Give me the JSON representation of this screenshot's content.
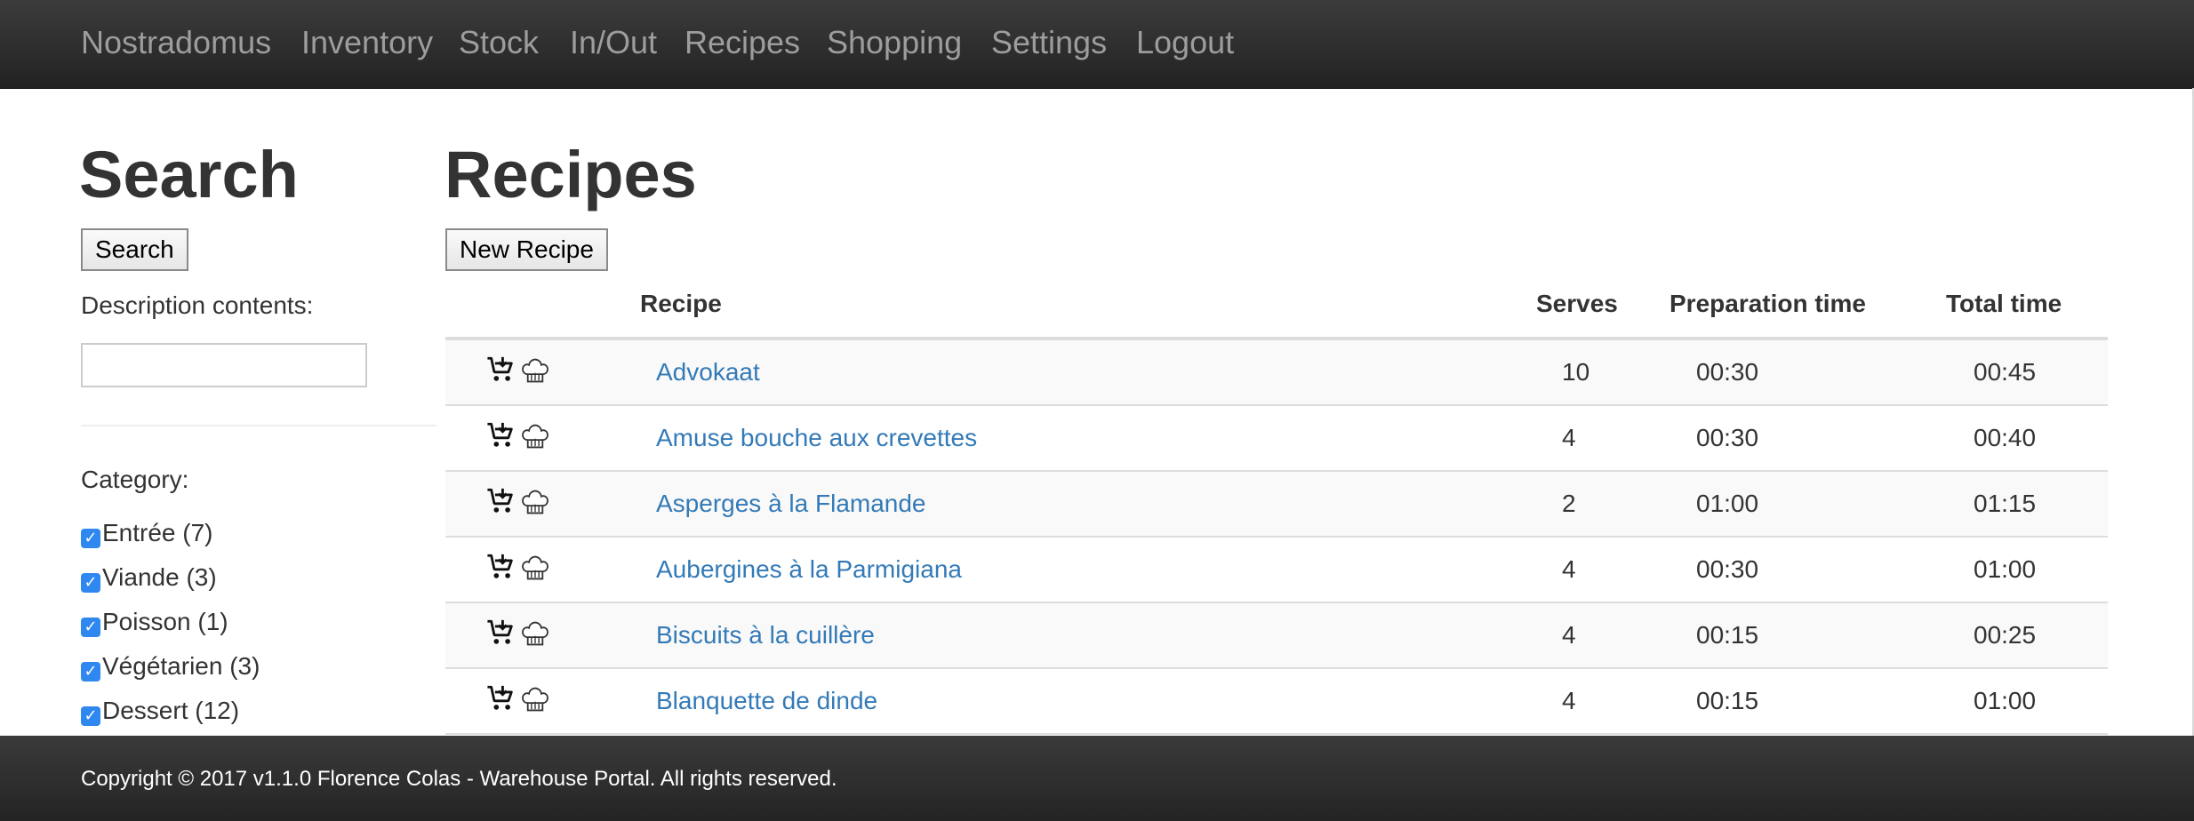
{
  "nav": {
    "items": [
      {
        "label": "Nostradomus"
      },
      {
        "label": "Inventory"
      },
      {
        "label": "Stock"
      },
      {
        "label": "In/Out"
      },
      {
        "label": "Recipes"
      },
      {
        "label": "Shopping"
      },
      {
        "label": "Settings"
      },
      {
        "label": "Logout"
      }
    ]
  },
  "sidebar": {
    "title": "Search",
    "search_button": "Search",
    "description_label": "Description contents:",
    "description_value": "",
    "category_label": "Category:",
    "categories": [
      {
        "label": "Entrée (7)",
        "checked": true
      },
      {
        "label": "Viande (3)",
        "checked": true
      },
      {
        "label": "Poisson (1)",
        "checked": true
      },
      {
        "label": "Végétarien (3)",
        "checked": true
      },
      {
        "label": "Dessert (12)",
        "checked": true
      }
    ]
  },
  "main": {
    "title": "Recipes",
    "new_button": "New Recipe",
    "columns": {
      "recipe": "Recipe",
      "serves": "Serves",
      "prep": "Preparation time",
      "total": "Total time"
    },
    "rows": [
      {
        "name": "Advokaat",
        "serves": "10",
        "prep": "00:30",
        "total": "00:45"
      },
      {
        "name": "Amuse bouche aux crevettes",
        "serves": "4",
        "prep": "00:30",
        "total": "00:40"
      },
      {
        "name": "Asperges à la Flamande",
        "serves": "2",
        "prep": "01:00",
        "total": "01:15"
      },
      {
        "name": "Aubergines à la Parmigiana",
        "serves": "4",
        "prep": "00:30",
        "total": "01:00"
      },
      {
        "name": "Biscuits à la cuillère",
        "serves": "4",
        "prep": "00:15",
        "total": "00:25"
      },
      {
        "name": "Blanquette de dinde",
        "serves": "4",
        "prep": "00:15",
        "total": "01:00"
      }
    ],
    "row_icons": [
      "add-to-cart-icon",
      "chef-hat-icon"
    ]
  },
  "footer": {
    "text": "Copyright © 2017 v1.1.0 Florence Colas - Warehouse Portal. All rights reserved."
  },
  "colors": {
    "navbar_bg": "#222222",
    "nav_link": "#9d9d9d",
    "link": "#337ab7",
    "checkbox": "#2f88ef",
    "footer_bg": "#2a2a2a"
  }
}
